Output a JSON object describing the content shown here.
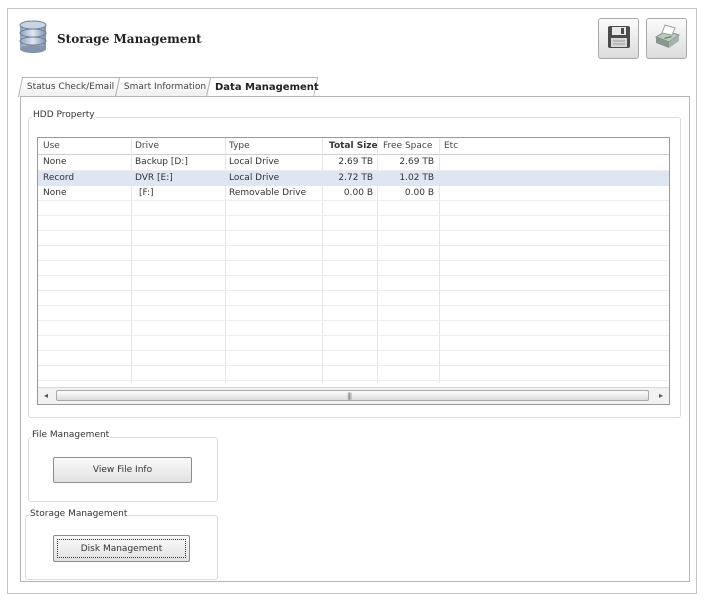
{
  "header": {
    "title": "Storage Management",
    "icons": {
      "app": "database-icon",
      "save": "floppy-disk-icon",
      "print": "printer-icon"
    }
  },
  "tabs": [
    {
      "label": "Status Check/Email",
      "active": false
    },
    {
      "label": "Smart Information",
      "active": false
    },
    {
      "label": "Data Management",
      "active": true
    }
  ],
  "hdd_property": {
    "label": "HDD Property",
    "columns": [
      "Use",
      "Drive",
      "Type",
      "Total Size",
      "Free Space",
      "Etc"
    ],
    "rows": [
      {
        "use": "None",
        "drive": "Backup [D:]",
        "type": "Local Drive",
        "total": "2.69 TB",
        "free": "2.69 TB",
        "etc": "",
        "selected": false
      },
      {
        "use": "Record",
        "drive": "DVR [E:]",
        "type": "Local Drive",
        "total": "2.72 TB",
        "free": "1.02 TB",
        "etc": "",
        "selected": true
      },
      {
        "use": "None",
        "drive": "[F:]",
        "type": "Removable Drive",
        "total": "0.00 B",
        "free": "0.00 B",
        "etc": "",
        "selected": false
      }
    ]
  },
  "file_management": {
    "label": "File Management",
    "button": "View File Info"
  },
  "storage_management": {
    "label": "Storage Management",
    "button": "Disk Management"
  },
  "colors": {
    "selection": "#dde6f2",
    "border": "#b4b4b4"
  }
}
